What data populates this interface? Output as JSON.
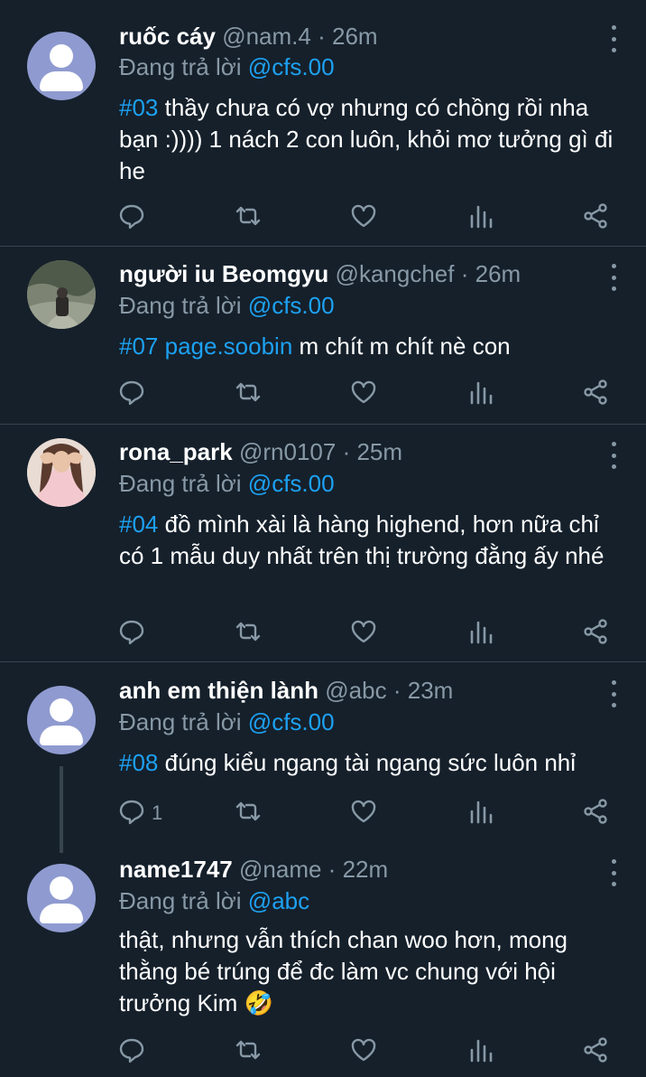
{
  "labels": {
    "replying_to": "Đang trả lời",
    "separator": "·"
  },
  "tweets": [
    {
      "name": "ruốc cáy",
      "handle": "@nam.4",
      "time": "26m",
      "reply_to": "@cfs.00",
      "hashtag": "#03",
      "text": " thầy chưa có vợ nhưng có chồng rồi nha bạn :)))) 1 nách 2 con luôn, khỏi mơ tưởng gì đi he",
      "avatar": "default-avatar"
    },
    {
      "name": "người iu Beomgyu",
      "handle": "@kangchef",
      "time": "26m",
      "reply_to": "@cfs.00",
      "hashtag": "#07 page.soobin",
      "text": " m chít m chít nè con",
      "avatar": "photo-avatar"
    },
    {
      "name": "rona_park",
      "handle": "@rn0107",
      "time": "25m",
      "reply_to": "@cfs.00",
      "hashtag": "#04",
      "text": " đồ mình xài là hàng highend, hơn nữa chỉ có 1 mẫu duy nhất trên thị trường đằng ấy nhé",
      "avatar": "photo-avatar"
    },
    {
      "name": "anh em thiện lành",
      "handle": "@abc",
      "time": "23m",
      "reply_to": "@cfs.00",
      "hashtag": "#08",
      "text": " đúng kiểu ngang tài ngang sức luôn nhỉ",
      "reply_count": "1",
      "avatar": "default-avatar"
    },
    {
      "name": "name1747",
      "handle": "@name",
      "time": "22m",
      "reply_to": "@abc",
      "hashtag": "",
      "text": "thật, nhưng vẫn thích chan woo hơn, mong thằng bé trúng để đc làm vc chung với hội trưởng Kim 🤣",
      "avatar": "default-avatar"
    }
  ],
  "icons": [
    "reply-icon",
    "retweet-icon",
    "like-icon",
    "analytics-icon",
    "share-icon",
    "more-icon"
  ]
}
